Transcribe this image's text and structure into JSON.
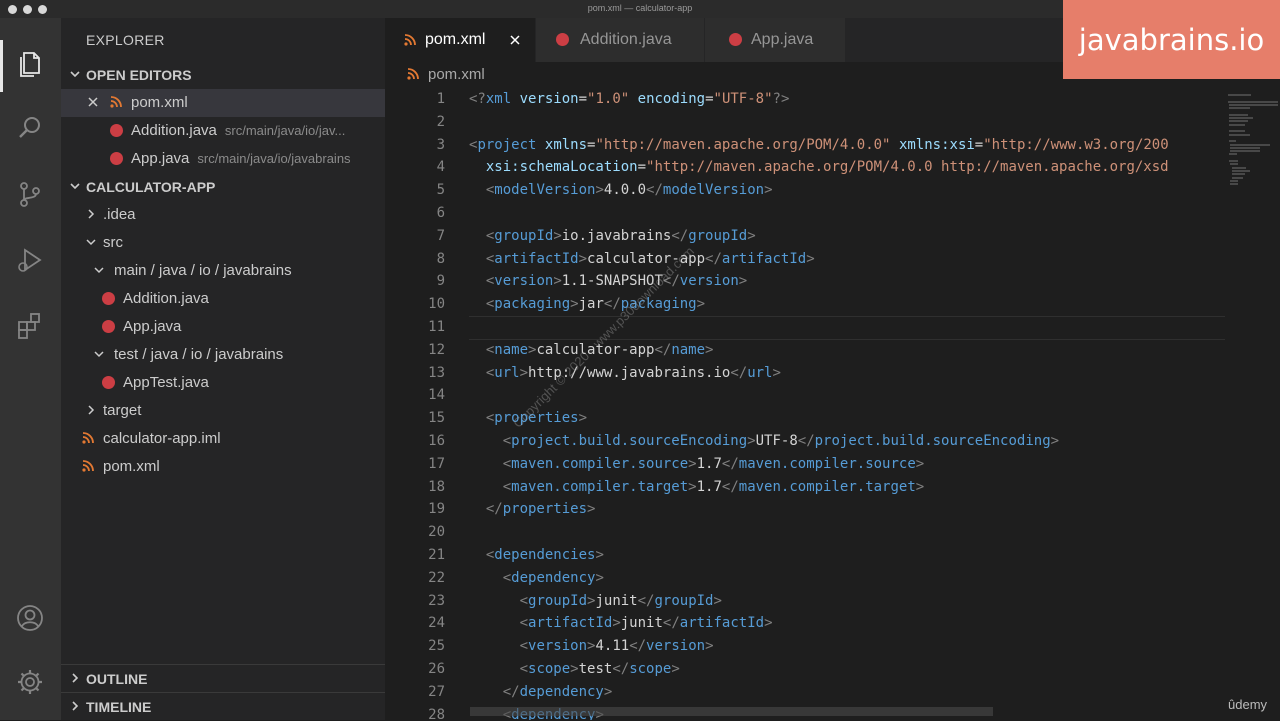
{
  "window_title": "pom.xml — calculator-app",
  "activity_bar": [
    "files-icon",
    "search-icon",
    "source-control-icon",
    "run-debug-icon",
    "extensions-icon",
    "account-icon",
    "settings-gear-icon"
  ],
  "sidebar": {
    "title": "EXPLORER",
    "open_editors": {
      "label": "OPEN EDITORS",
      "items": [
        {
          "name": "pom.xml",
          "path": ""
        },
        {
          "name": "Addition.java",
          "path": "src/main/java/io/jav..."
        },
        {
          "name": "App.java",
          "path": "src/main/java/io/javabrains"
        }
      ]
    },
    "project": {
      "label": "CALCULATOR-APP",
      "tree": [
        ".idea",
        "src",
        "main / java / io / javabrains",
        "Addition.java",
        "App.java",
        "test / java / io / javabrains",
        "AppTest.java",
        "target",
        "calculator-app.iml",
        "pom.xml"
      ]
    },
    "outline_label": "OUTLINE",
    "timeline_label": "TIMELINE"
  },
  "tabs": [
    {
      "label": "pom.xml",
      "active": true
    },
    {
      "label": "Addition.java",
      "active": false
    },
    {
      "label": "App.java",
      "active": false
    }
  ],
  "breadcrumb": "pom.xml",
  "editor": {
    "line_numbers": [
      "1",
      "2",
      "3",
      "4",
      "5",
      "6",
      "7",
      "8",
      "9",
      "10",
      "11",
      "12",
      "13",
      "14",
      "15",
      "16",
      "17",
      "18",
      "19",
      "20",
      "21",
      "22",
      "23",
      "24",
      "25",
      "26",
      "27",
      "28"
    ],
    "lines": [
      "<?xml version=\"1.0\" encoding=\"UTF-8\"?>",
      "",
      "<project xmlns=\"http://maven.apache.org/POM/4.0.0\" xmlns:xsi=\"http://www.w3.org/200",
      "  xsi:schemaLocation=\"http://maven.apache.org/POM/4.0.0 http://maven.apache.org/xsd",
      "  <modelVersion>4.0.0</modelVersion>",
      "",
      "  <groupId>io.javabrains</groupId>",
      "  <artifactId>calculator-app</artifactId>",
      "  <version>1.1-SNAPSHOT</version>",
      "  <packaging>jar</packaging>",
      "",
      "  <name>calculator-app</name>",
      "  <url>http://www.javabrains.io</url>",
      "",
      "  <properties>",
      "    <project.build.sourceEncoding>UTF-8</project.build.sourceEncoding>",
      "    <maven.compiler.source>1.7</maven.compiler.source>",
      "    <maven.compiler.target>1.7</maven.compiler.target>",
      "  </properties>",
      "",
      "  <dependencies>",
      "    <dependency>",
      "      <groupId>junit</groupId>",
      "      <artifactId>junit</artifactId>",
      "      <version>4.11</version>",
      "      <scope>test</scope>",
      "    </dependency>",
      "    <dependency>"
    ]
  },
  "logo_text": "javabrains.io",
  "watermark": "Copyright © 2020 - www.p30download.com",
  "udemy_label": "ûdemy"
}
